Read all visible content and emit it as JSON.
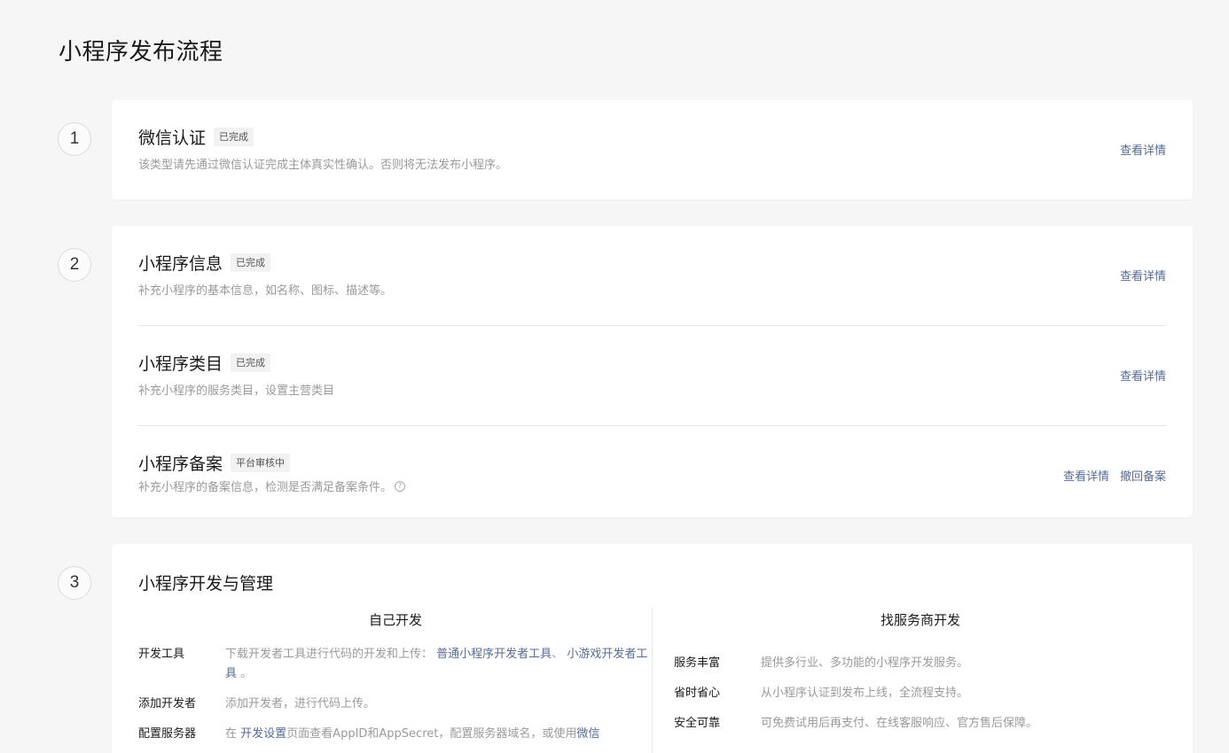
{
  "page_title": "小程序发布流程",
  "steps": [
    {
      "number": "1",
      "items": [
        {
          "title": "微信认证",
          "badge": "已完成",
          "desc": "该类型请先通过微信认证完成主体真实性确认。否则将无法发布小程序。",
          "actions": [
            "查看详情"
          ]
        }
      ]
    },
    {
      "number": "2",
      "items": [
        {
          "title": "小程序信息",
          "badge": "已完成",
          "desc": "补充小程序的基本信息，如名称、图标、描述等。",
          "actions": [
            "查看详情"
          ]
        },
        {
          "title": "小程序类目",
          "badge": "已完成",
          "desc": "补充小程序的服务类目，设置主营类目",
          "actions": [
            "查看详情"
          ]
        },
        {
          "title": "小程序备案",
          "badge": "平台审核中",
          "desc": "补充小程序的备案信息，检测是否满足备案条件。",
          "help_icon": "question-circle-icon",
          "actions": [
            "查看详情",
            "撤回备案"
          ]
        }
      ]
    },
    {
      "number": "3",
      "title": "小程序开发与管理",
      "self_dev": {
        "heading": "自己开发",
        "rows": [
          {
            "label": "开发工具",
            "text_prefix": "下载开发者工具进行代码的开发和上传：",
            "link1": "普通小程序开发者工具",
            "sep": "、",
            "link2": "小游戏开发者工具",
            "text_suffix": "。"
          },
          {
            "label": "添加开发者",
            "text": "添加开发者，进行代码上传。"
          },
          {
            "label": "配置服务器",
            "text_prefix": "在",
            "link1": "开发设置",
            "text_middle": "页面查看AppID和AppSecret，配置服务器域名，或使用",
            "link2": "微信"
          }
        ]
      },
      "vendor_dev": {
        "heading": "找服务商开发",
        "rows": [
          {
            "label": "服务丰富",
            "text": "提供多行业、多功能的小程序开发服务。"
          },
          {
            "label": "省时省心",
            "text": "从小程序认证到发布上线，全流程支持。"
          },
          {
            "label": "安全可靠",
            "text": "可免费试用后再支付、在线客服响应、官方售后保障。"
          }
        ]
      }
    }
  ],
  "colors": {
    "link": "#576b95",
    "background": "#f6f6f6",
    "card": "#ffffff",
    "muted_text": "#9a9a9a"
  }
}
